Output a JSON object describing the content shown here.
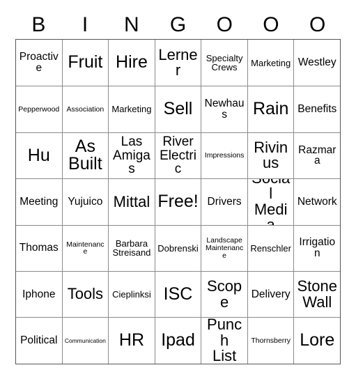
{
  "card": {
    "header_letters": [
      "B",
      "I",
      "N",
      "G",
      "O",
      "O",
      "O"
    ],
    "rows": [
      [
        {
          "label": "Proactive",
          "size": "md"
        },
        {
          "label": "Fruit",
          "size": "xxl"
        },
        {
          "label": "Hire",
          "size": "xxl"
        },
        {
          "label": "Lerner",
          "size": "xl"
        },
        {
          "label": "Specialty\nCrews",
          "size": "sm"
        },
        {
          "label": "Marketing",
          "size": "sm"
        },
        {
          "label": "Westley",
          "size": "md"
        }
      ],
      [
        {
          "label": "Pepperwood",
          "size": "xs"
        },
        {
          "label": "Association",
          "size": "xs"
        },
        {
          "label": "Marketing",
          "size": "sm"
        },
        {
          "label": "Sell",
          "size": "xxl"
        },
        {
          "label": "Newhaus",
          "size": "md"
        },
        {
          "label": "Rain",
          "size": "xxl"
        },
        {
          "label": "Benefits",
          "size": "md"
        }
      ],
      [
        {
          "label": "Hu",
          "size": "xxl"
        },
        {
          "label": "As\nBuilt",
          "size": "xxl"
        },
        {
          "label": "Las\nAmigas",
          "size": "lg"
        },
        {
          "label": "River\nElectric",
          "size": "lg"
        },
        {
          "label": "Impressions",
          "size": "xs"
        },
        {
          "label": "Rivinus",
          "size": "xl"
        },
        {
          "label": "Razmara",
          "size": "md"
        }
      ],
      [
        {
          "label": "Meeting",
          "size": "md"
        },
        {
          "label": "Yujuico",
          "size": "md"
        },
        {
          "label": "Mittal",
          "size": "xl"
        },
        {
          "label": "Free!",
          "size": "xxl"
        },
        {
          "label": "Drivers",
          "size": "md"
        },
        {
          "label": "Social\nMedia",
          "size": "xl"
        },
        {
          "label": "Network",
          "size": "md"
        }
      ],
      [
        {
          "label": "Thomas",
          "size": "md"
        },
        {
          "label": "Maintenance",
          "size": "xs"
        },
        {
          "label": "Barbara\nStreisand",
          "size": "sm"
        },
        {
          "label": "Dobrenski",
          "size": "sm"
        },
        {
          "label": "Landscape\nMaintenance",
          "size": "xs"
        },
        {
          "label": "Renschler",
          "size": "sm"
        },
        {
          "label": "Irrigation",
          "size": "md"
        }
      ],
      [
        {
          "label": "Iphone",
          "size": "md"
        },
        {
          "label": "Tools",
          "size": "xl"
        },
        {
          "label": "Cieplinksi",
          "size": "sm"
        },
        {
          "label": "ISC",
          "size": "xxl"
        },
        {
          "label": "Scope",
          "size": "xl"
        },
        {
          "label": "Delivery",
          "size": "md"
        },
        {
          "label": "Stone\nWall",
          "size": "xl"
        }
      ],
      [
        {
          "label": "Political",
          "size": "md"
        },
        {
          "label": "Communication",
          "size": "xxs"
        },
        {
          "label": "HR",
          "size": "xxl"
        },
        {
          "label": "Ipad",
          "size": "xxl"
        },
        {
          "label": "Punch\nList",
          "size": "xl"
        },
        {
          "label": "Thornsberry",
          "size": "xs"
        },
        {
          "label": "Lore",
          "size": "xxl"
        }
      ]
    ]
  },
  "colors": {
    "background": "#ffffff",
    "text": "#000000",
    "grid_inner_border": "#8a8a8a",
    "grid_outer_border": "#555555"
  }
}
